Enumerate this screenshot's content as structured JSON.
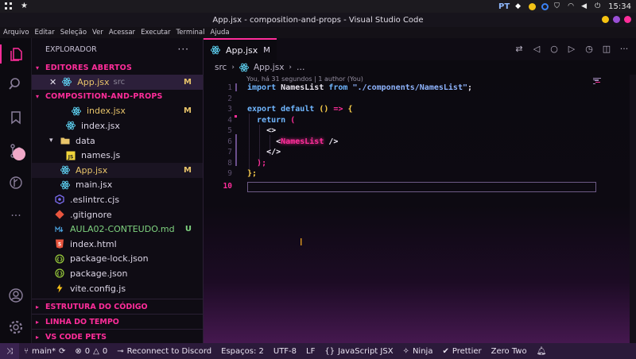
{
  "system": {
    "locale": "PT",
    "clock": "15:34"
  },
  "window": {
    "title": "App.jsx - composition-and-props - Visual Studio Code"
  },
  "menu": [
    "Arquivo",
    "Editar",
    "Seleção",
    "Ver",
    "Acessar",
    "Executar",
    "Terminal",
    "Ajuda"
  ],
  "sidebar": {
    "title": "EXPLORADOR",
    "open_editors": {
      "label": "EDITORES ABERTOS",
      "items": [
        {
          "name": "App.jsx",
          "folder": "src",
          "badge": "M"
        }
      ]
    },
    "project": {
      "label": "COMPOSITION-AND-PROPS",
      "items": [
        {
          "name": "index.jsx",
          "badge": "M",
          "icon": "react-icon"
        },
        {
          "name": "index.jsx",
          "badge": "",
          "icon": "react-icon"
        },
        {
          "name": "data",
          "badge": "",
          "icon": "folder-icon"
        },
        {
          "name": "names.js",
          "badge": "",
          "icon": "js-icon"
        },
        {
          "name": "App.jsx",
          "badge": "M",
          "icon": "react-icon"
        },
        {
          "name": "main.jsx",
          "badge": "",
          "icon": "react-icon"
        },
        {
          "name": ".eslintrc.cjs",
          "badge": "",
          "icon": "eslint-icon"
        },
        {
          "name": ".gitignore",
          "badge": "",
          "icon": "git-icon"
        },
        {
          "name": "AULA02-CONTEUDO.md",
          "badge": "U",
          "icon": "markdown-icon"
        },
        {
          "name": "index.html",
          "badge": "",
          "icon": "html-icon"
        },
        {
          "name": "package-lock.json",
          "badge": "",
          "icon": "json-icon"
        },
        {
          "name": "package.json",
          "badge": "",
          "icon": "json-icon"
        },
        {
          "name": "vite.config.js",
          "badge": "",
          "icon": "vite-icon"
        }
      ]
    },
    "bottom_sections": [
      "ESTRUTURA DO CÓDIGO",
      "LINHA DO TEMPO",
      "VS CODE PETS"
    ]
  },
  "editor": {
    "tab": {
      "label": "App.jsx",
      "modified": "M"
    },
    "breadcrumbs": [
      "src",
      "App.jsx",
      "…"
    ],
    "blame": "You, há 31 segundos | 1 author (You)",
    "line_numbers": [
      "1",
      "2",
      "3",
      "4",
      "5",
      "6",
      "7",
      "8",
      "9",
      "10"
    ],
    "code": {
      "l1": {
        "import": "import",
        "name": "NamesList",
        "from": "from",
        "path": "\"./components/NamesList\"",
        "semi": ";"
      },
      "l3": {
        "export": "export",
        "default": "default",
        "parens": "()",
        "arrow": "=>",
        "brace": "{"
      },
      "l4": {
        "return": "return",
        "paren": "("
      },
      "l5": {
        "frag_open": "<>"
      },
      "l6": {
        "lt": "<",
        "component": "NamesList",
        "close": " />"
      },
      "l7": {
        "frag_close": "</>"
      },
      "l8": {
        "paren_close": ");"
      },
      "l9": {
        "brace_close": "};"
      }
    }
  },
  "statusbar": {
    "branch": "main*",
    "errors": "0",
    "warnings": "0",
    "discord": "Reconnect to Discord",
    "spaces": "Espaços: 2",
    "encoding": "UTF-8",
    "eol": "LF",
    "language": "JavaScript JSX",
    "ninja": "Ninja",
    "prettier": "Prettier",
    "theme": "Zero Two"
  },
  "colors": {
    "accent": "#ff2d9a",
    "modified": "#e8c46a",
    "untracked": "#7fd37f"
  }
}
